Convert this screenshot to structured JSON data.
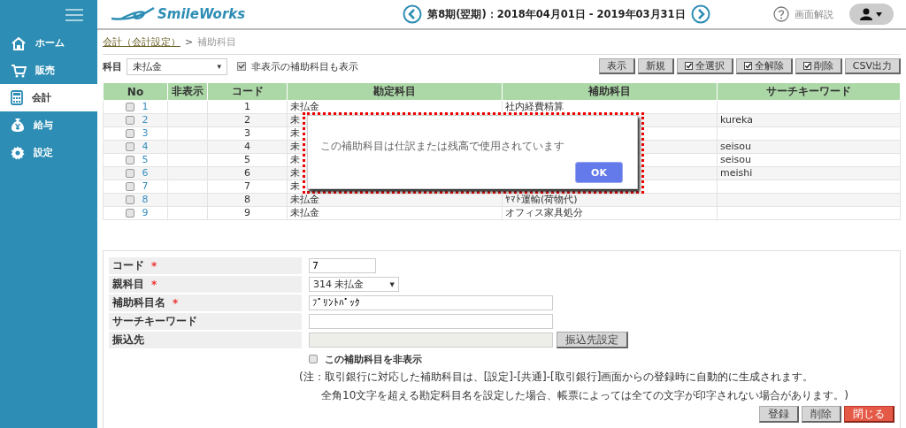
{
  "sidebar": {
    "items": [
      {
        "label": "ホーム",
        "selected": false
      },
      {
        "label": "販売",
        "selected": false
      },
      {
        "label": "会計",
        "selected": true
      },
      {
        "label": "給与",
        "selected": false
      },
      {
        "label": "設定",
        "selected": false
      }
    ]
  },
  "header": {
    "logo": "SmileWorks",
    "period": "第8期(翌期)：2018年04月01日 - 2019年03月31日",
    "help": "画面解説"
  },
  "breadcrumb": {
    "link": "会計（会計設定）",
    "separator": ">",
    "current": "補助科目"
  },
  "filter": {
    "label": "科目",
    "select": "未払金",
    "caret": "▾",
    "show_hidden": {
      "label": "非表示の補助科目も表示",
      "checked": true
    }
  },
  "toolbar": [
    {
      "label": "表示",
      "kind": "plain"
    },
    {
      "label": "新規",
      "kind": "plain"
    },
    {
      "label": "全選択",
      "kind": "check"
    },
    {
      "label": "全解除",
      "kind": "check"
    },
    {
      "label": "削除",
      "kind": "check"
    },
    {
      "label": "CSV出力",
      "kind": "plain"
    }
  ],
  "table": {
    "columns": [
      "No",
      "非表示",
      "コード",
      "勘定科目",
      "補助科目",
      "サーチキーワード"
    ],
    "rows": [
      {
        "no": "1",
        "checked": false,
        "code": "1",
        "account": "未払金",
        "sub": "社内経費精算"
      },
      {
        "no": "2",
        "checked": false,
        "code": "2",
        "account": "未",
        "keyword": "kureka"
      },
      {
        "no": "3",
        "checked": false,
        "code": "3",
        "account": "未"
      },
      {
        "no": "4",
        "checked": false,
        "code": "4",
        "account": "未",
        "keyword": "seisou"
      },
      {
        "no": "5",
        "checked": false,
        "code": "5",
        "account": "未",
        "keyword": "seisou"
      },
      {
        "no": "6",
        "checked": false,
        "code": "6",
        "account": "未",
        "keyword": "meishi"
      },
      {
        "no": "7",
        "checked": false,
        "code": "7",
        "account": "未"
      },
      {
        "no": "8",
        "checked": false,
        "code": "8",
        "account": "未払金",
        "sub": "ﾔﾏﾄ運輸(荷物代)"
      },
      {
        "no": "9",
        "checked": false,
        "code": "9",
        "account": "未払金",
        "sub": "オフィス家具処分"
      }
    ]
  },
  "form": {
    "fields": [
      {
        "label": "コード",
        "required_mark": "*",
        "kind": "short",
        "value": "7"
      },
      {
        "label": "親科目",
        "required_mark": "*",
        "kind": "select",
        "value": "314  未払金",
        "caret": "▼"
      },
      {
        "label": "補助科目名",
        "required_mark": "*",
        "kind": "wide",
        "value": "ﾌﾟﾘﾝﾄﾊﾟｯｸ"
      },
      {
        "label": "サーチキーワード",
        "kind": "wide"
      },
      {
        "label": "振込先",
        "kind": "disabled",
        "button": "振込先設定"
      }
    ],
    "hide": {
      "label": "この補助科目を非表示",
      "checked": false
    },
    "notes": [
      "(注：取引銀行に対応した補助科目は、[設定]-[共通]-[取引銀行]画面からの登録時に自動的に生成されます。",
      "全角10文字を超える勘定科目名を設定した場合、帳票によっては全ての文字が印字されない場合があります。)"
    ],
    "buttons": [
      {
        "label": "登録",
        "kind": "plain"
      },
      {
        "label": "削除",
        "kind": "plain"
      },
      {
        "label": "閉じる",
        "kind": "danger"
      }
    ]
  },
  "dialog": {
    "message": "この補助科目は仕訳または残高で使用されています",
    "button": "OK"
  }
}
